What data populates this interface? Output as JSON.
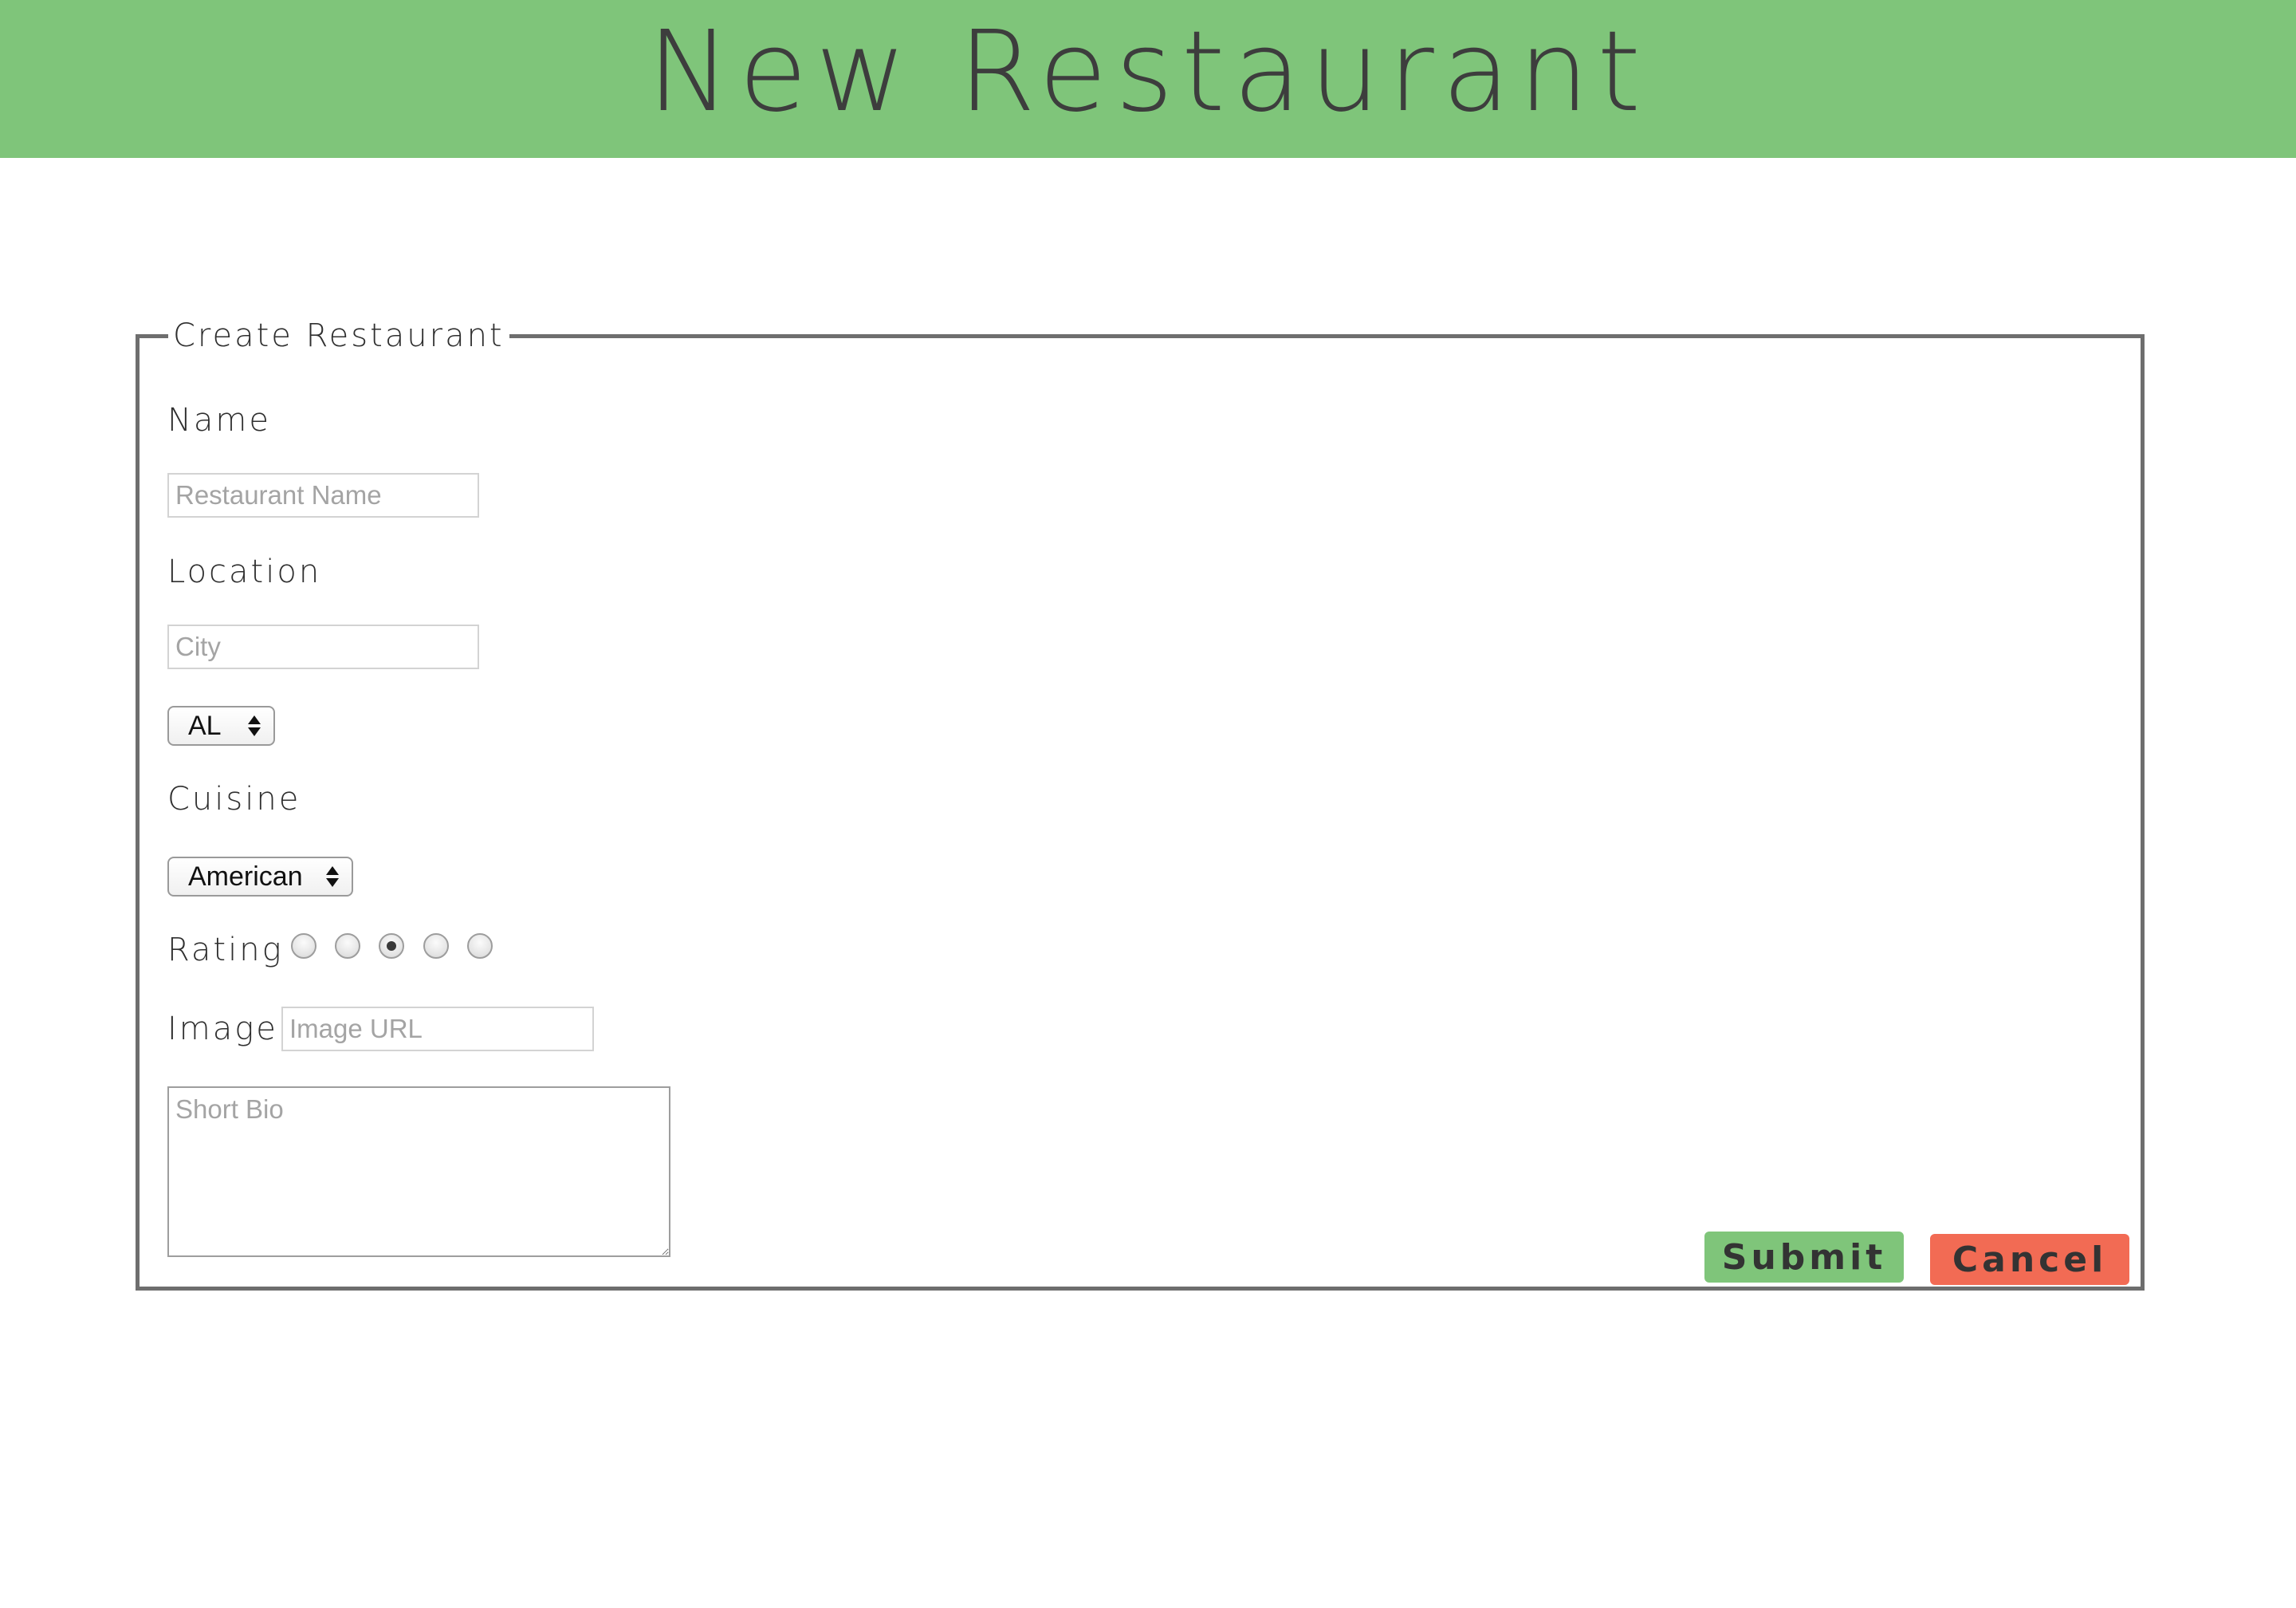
{
  "page": {
    "title": "New Restaurant",
    "header_color": "#7fc57a"
  },
  "form": {
    "legend": "Create Restaurant",
    "name": {
      "label": "Name",
      "placeholder": "Restaurant Name",
      "value": ""
    },
    "location": {
      "label": "Location",
      "city_placeholder": "City",
      "city_value": "",
      "state_selected": "AL"
    },
    "cuisine": {
      "label": "Cuisine",
      "selected": "American"
    },
    "rating": {
      "label": "Rating",
      "options": 5,
      "selected": 3
    },
    "image": {
      "label": "Image",
      "placeholder": "Image URL",
      "value": ""
    },
    "bio": {
      "placeholder": "Short Bio",
      "value": ""
    },
    "buttons": {
      "submit_label": "Submit",
      "submit_color": "#7fc57a",
      "cancel_label": "Cancel",
      "cancel_color": "#f26b54"
    }
  }
}
